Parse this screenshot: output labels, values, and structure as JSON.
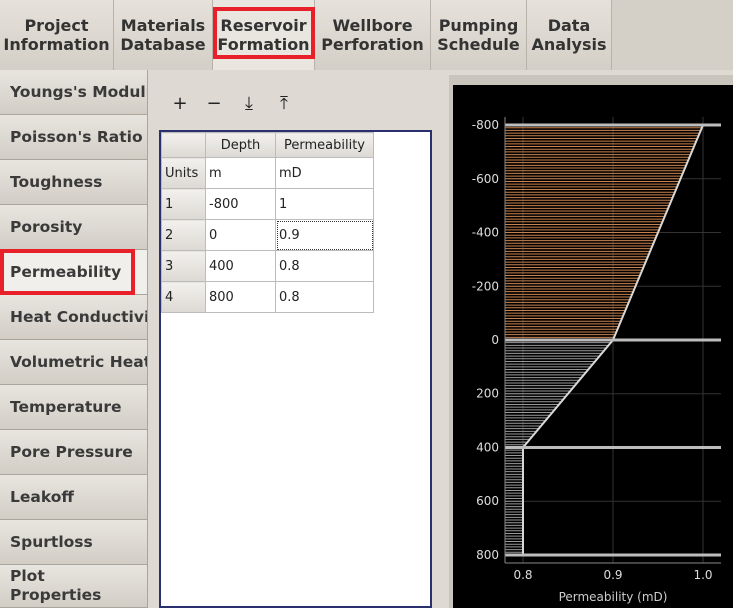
{
  "top_tabs": [
    {
      "label": "Project\nInformation"
    },
    {
      "label": "Materials\nDatabase"
    },
    {
      "label": "Reservoir\nFormation"
    },
    {
      "label": "Wellbore\nPerforation"
    },
    {
      "label": "Pumping\nSchedule"
    },
    {
      "label": "Data\nAnalysis"
    }
  ],
  "sidebar": {
    "items": [
      {
        "label": "Youngs's Modulus"
      },
      {
        "label": "Poisson's Ratio"
      },
      {
        "label": "Toughness"
      },
      {
        "label": "Porosity"
      },
      {
        "label": "Permeability"
      },
      {
        "label": "Heat Conductivity"
      },
      {
        "label": "Volumetric Heat C"
      },
      {
        "label": "Temperature"
      },
      {
        "label": "Pore Pressure"
      },
      {
        "label": "Leakoff"
      },
      {
        "label": "Spurtloss"
      },
      {
        "label": "Plot\nProperties"
      }
    ]
  },
  "toolbar": {
    "add": "+",
    "remove": "−",
    "import": "⤓",
    "export": "⤒"
  },
  "table": {
    "headers": [
      "Depth",
      "Permeability"
    ],
    "units_label": "Units",
    "units": [
      "m",
      "mD"
    ],
    "rows": [
      {
        "n": "1",
        "depth": "-800",
        "perm": "1"
      },
      {
        "n": "2",
        "depth": "0",
        "perm": "0.9"
      },
      {
        "n": "3",
        "depth": "400",
        "perm": "0.8"
      },
      {
        "n": "4",
        "depth": "800",
        "perm": "0.8"
      }
    ]
  },
  "chart_data": {
    "type": "area",
    "xlabel": "Permeability (mD)",
    "ylabel": "",
    "x_ticks": [
      "0.8",
      "0.9",
      "1.0"
    ],
    "y_ticks": [
      "-800",
      "-600",
      "-400",
      "-200",
      "0",
      "200",
      "400",
      "600",
      "800"
    ],
    "xlim": [
      0.78,
      1.02
    ],
    "ylim": [
      -830,
      830
    ],
    "y_inverted": true,
    "grid": true,
    "points": [
      {
        "depth": -800,
        "perm": 1.0
      },
      {
        "depth": 0,
        "perm": 0.9
      },
      {
        "depth": 400,
        "perm": 0.8
      },
      {
        "depth": 800,
        "perm": 0.8
      }
    ],
    "fill_colors": {
      "upper": "#c8824e",
      "lower": "#9a9a9a"
    },
    "boundary_depths": [
      -800,
      0,
      400,
      800
    ]
  }
}
